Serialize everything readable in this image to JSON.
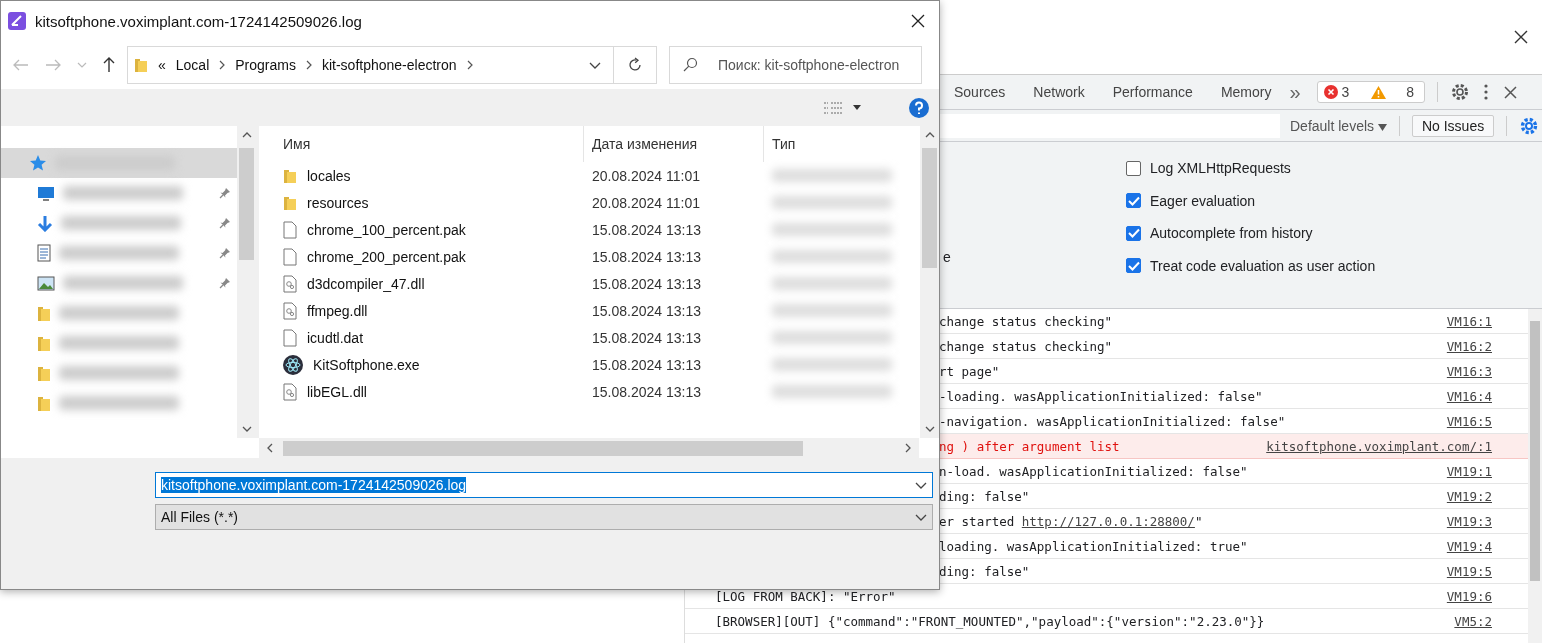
{
  "devtools": {
    "tabs": [
      {
        "label": "Sources"
      },
      {
        "label": "Network"
      },
      {
        "label": "Performance"
      },
      {
        "label": "Memory"
      }
    ],
    "overflow": "»",
    "error_count": "3",
    "warning_count": "8",
    "filter": {
      "levels": "Default levels",
      "issues": "No Issues"
    },
    "settings": {
      "fragment": "e",
      "checkboxes": [
        {
          "label": "Log XMLHttpRequests",
          "checked": false
        },
        {
          "label": "Eager evaluation",
          "checked": true
        },
        {
          "label": "Autocomplete from history",
          "checked": true
        },
        {
          "label": "Treat code evaluation as user action",
          "checked": true
        }
      ]
    },
    "console": {
      "partial_rows": [
        {
          "kind": "log",
          "text": "change status checking\"",
          "source": "VM16:1"
        },
        {
          "kind": "log",
          "text": "change status checking\"",
          "source": "VM16:2"
        },
        {
          "kind": "log",
          "text": "rt page\"",
          "source": "VM16:3"
        },
        {
          "kind": "log",
          "text": "-loading. wasApplicationInitialized: false\"",
          "source": "VM16:4"
        },
        {
          "kind": "log",
          "text": "-navigation. wasApplicationInitialized: false\"",
          "source": "VM16:5"
        },
        {
          "kind": "error",
          "text": "ng ) after argument list",
          "source": "kitsoftphone.voximplant.com/:1"
        },
        {
          "kind": "log",
          "text": "n-load. wasApplicationInitialized: false\"",
          "source": "VM19:1"
        },
        {
          "kind": "log",
          "text": "ding: false\"",
          "source": "VM19:2"
        },
        {
          "kind": "log",
          "text": "er started ",
          "link": "http://127.0.0.1:28800/",
          "after": "\"",
          "source": "VM19:3"
        },
        {
          "kind": "log",
          "text": "loading. wasApplicationInitialized: true\"",
          "source": "VM19:4"
        },
        {
          "kind": "log",
          "text": "ding: false\"",
          "source": "VM19:5"
        }
      ],
      "rows": [
        {
          "kind": "log",
          "text": "[LOG FROM BACK]: \"Error\"",
          "source": "VM19:6"
        },
        {
          "kind": "log",
          "text": "[BROWSER][OUT] {\"command\":\"FRONT_MOUNTED\",\"payload\":{\"version\":\"2.23.0\"}}",
          "source": "VM5:2"
        }
      ]
    }
  },
  "dialog": {
    "title": "kitsoftphone.voximplant.com-1724142509026.log",
    "breadcrumb": [
      "«",
      "Local",
      "Programs",
      "kit-softphone-electron"
    ],
    "search": {
      "placeholder": "Поиск: kit-softphone-electron"
    },
    "nav_items": [
      {
        "kind": "star",
        "pinned": false,
        "selected": true
      },
      {
        "kind": "desktop",
        "pinned": true,
        "selected": false
      },
      {
        "kind": "download",
        "pinned": true,
        "selected": false
      },
      {
        "kind": "document",
        "pinned": true,
        "selected": false
      },
      {
        "kind": "image",
        "pinned": true,
        "selected": false
      },
      {
        "kind": "folder",
        "pinned": false,
        "selected": false
      },
      {
        "kind": "folder",
        "pinned": false,
        "selected": false
      },
      {
        "kind": "folder",
        "pinned": false,
        "selected": false
      },
      {
        "kind": "folder",
        "pinned": false,
        "selected": false
      }
    ],
    "columns": [
      "Имя",
      "Дата изменения",
      "Тип"
    ],
    "files": [
      {
        "kind": "folder",
        "name": "locales",
        "date": "20.08.2024 11:01"
      },
      {
        "kind": "folder",
        "name": "resources",
        "date": "20.08.2024 11:01"
      },
      {
        "kind": "file",
        "name": "chrome_100_percent.pak",
        "date": "15.08.2024 13:13"
      },
      {
        "kind": "file",
        "name": "chrome_200_percent.pak",
        "date": "15.08.2024 13:13"
      },
      {
        "kind": "dll",
        "name": "d3dcompiler_47.dll",
        "date": "15.08.2024 13:13"
      },
      {
        "kind": "dll",
        "name": "ffmpeg.dll",
        "date": "15.08.2024 13:13"
      },
      {
        "kind": "file",
        "name": "icudtl.dat",
        "date": "15.08.2024 13:13"
      },
      {
        "kind": "exe",
        "name": "KitSoftphone.exe",
        "date": "15.08.2024 13:13"
      },
      {
        "kind": "dll",
        "name": "libEGL.dll",
        "date": "15.08.2024 13:13"
      }
    ],
    "filename": "kitsoftphone.voximplant.com-1724142509026.log",
    "filetype": "All Files (*.*)"
  }
}
